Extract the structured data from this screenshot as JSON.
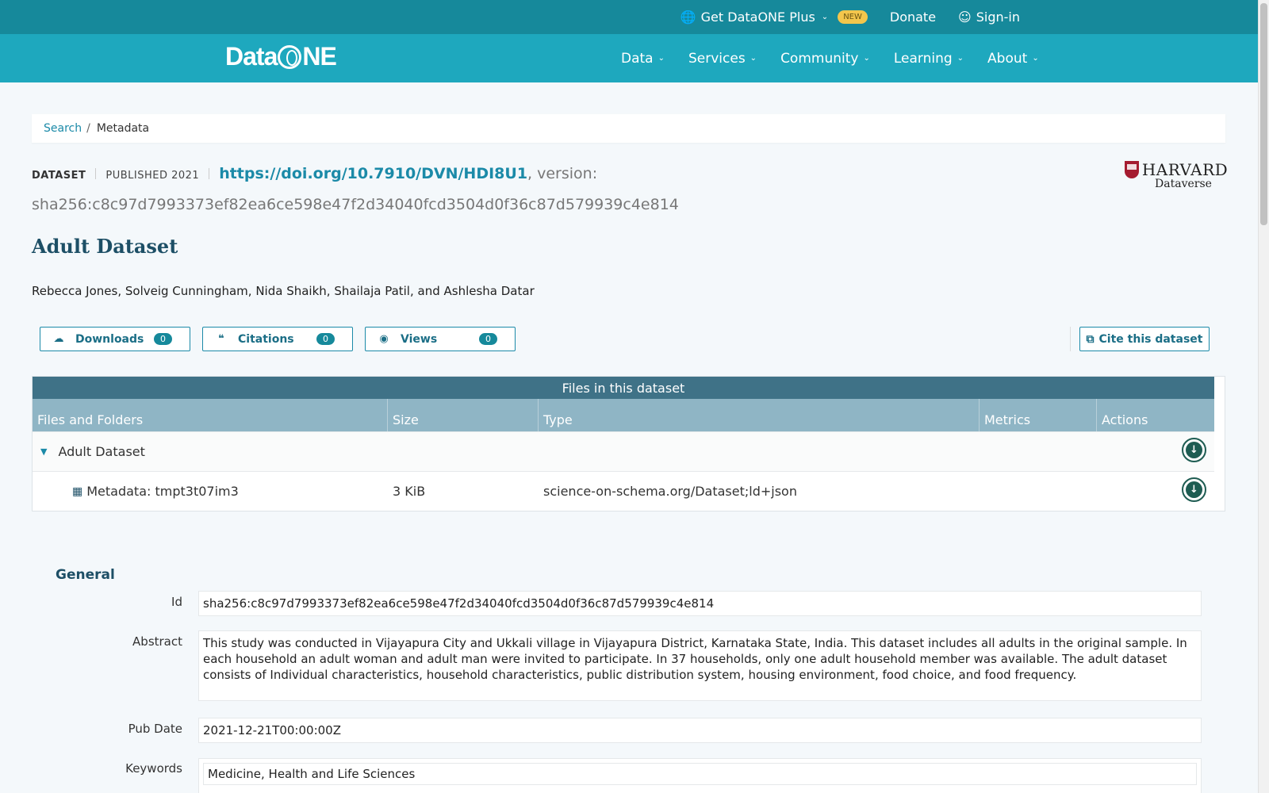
{
  "topbar": {
    "plus_label": "Get DataONE Plus",
    "new_badge": "NEW",
    "donate_label": "Donate",
    "signin_label": "Sign-in"
  },
  "nav": {
    "logo_left": "Data",
    "logo_right": "NE",
    "items": [
      "Data",
      "Services",
      "Community",
      "Learning",
      "About"
    ]
  },
  "breadcrumb": {
    "search": "Search",
    "sep": "/",
    "current": "Metadata"
  },
  "header": {
    "type": "DATASET",
    "published": "PUBLISHED 2021",
    "doi": "https://doi.org/10.7910/DVN/HDI8U1",
    "version_label": ", version:",
    "hash": "sha256:c8c97d7993373ef82ea6ce598e47f2d34040fcd3504d0f36c87d579939c4e814",
    "title": "Adult Dataset",
    "authors": "Rebecca Jones, Solveig Cunningham, Nida Shaikh, Shailaja Patil, and Ashlesha Datar",
    "repository": {
      "name": "HARVARD",
      "sub": "Dataverse"
    }
  },
  "metrics": {
    "downloads": {
      "label": "Downloads",
      "count": "0"
    },
    "citations": {
      "label": "Citations",
      "count": "0"
    },
    "views": {
      "label": "Views",
      "count": "0"
    },
    "cite_label": "Cite this dataset"
  },
  "files": {
    "caption": "Files in this dataset",
    "headers": [
      "Files and Folders",
      "Size",
      "Type",
      "Metrics",
      "Actions"
    ],
    "folder_name": "Adult Dataset",
    "file": {
      "name": "Metadata: tmpt3t07im3",
      "size": "3 KiB",
      "type": "science-on-schema.org/Dataset;ld+json"
    }
  },
  "general": {
    "section_title": "General",
    "id_label": "Id",
    "id_value": "sha256:c8c97d7993373ef82ea6ce598e47f2d34040fcd3504d0f36c87d579939c4e814",
    "abstract_label": "Abstract",
    "abstract_value": "This study was conducted in Vijayapura City and Ukkali village in Vijayapura District, Karnataka State, India. This dataset includes all adults in the original sample. In each household an adult woman and adult man were invited to participate. In 37 households, only one adult household member was available. The adult dataset consists of Individual characteristics, household characteristics, public distribution system, housing environment, food choice, and food frequency.",
    "pubdate_label": "Pub Date",
    "pubdate_value": "2021-12-21T00:00:00Z",
    "keywords_label": "Keywords",
    "keywords": [
      "Medicine, Health and Life Sciences"
    ]
  },
  "colors": {
    "topbar": "#16899b",
    "nav": "#1ea8be",
    "accent": "#1b8aa8",
    "table_caption": "#3f7287",
    "table_header": "#8fb5c5",
    "title": "#1d4f66"
  }
}
